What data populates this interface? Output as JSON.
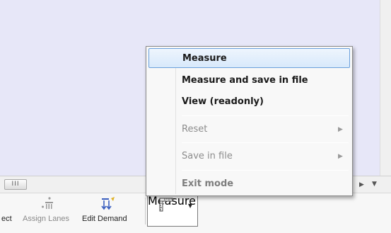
{
  "toolbar": {
    "buttons": [
      {
        "label": "ect"
      },
      {
        "label": "Assign Lanes"
      },
      {
        "label": "Edit Demand"
      },
      {
        "label": "Measure"
      }
    ]
  },
  "scroll": {
    "thumb_label": "III"
  },
  "menu": {
    "items": [
      {
        "label": "Measure"
      },
      {
        "label": "Measure and save in file"
      },
      {
        "label": "View (readonly)"
      },
      {
        "label": "Reset"
      },
      {
        "label": "Save in file"
      },
      {
        "label": "Exit mode"
      }
    ]
  },
  "icons": {
    "assign_lanes": "lanes-icon",
    "edit_demand": "demand-icon",
    "measure": "ruler-icon",
    "submenu": "submenu-arrow-icon"
  }
}
